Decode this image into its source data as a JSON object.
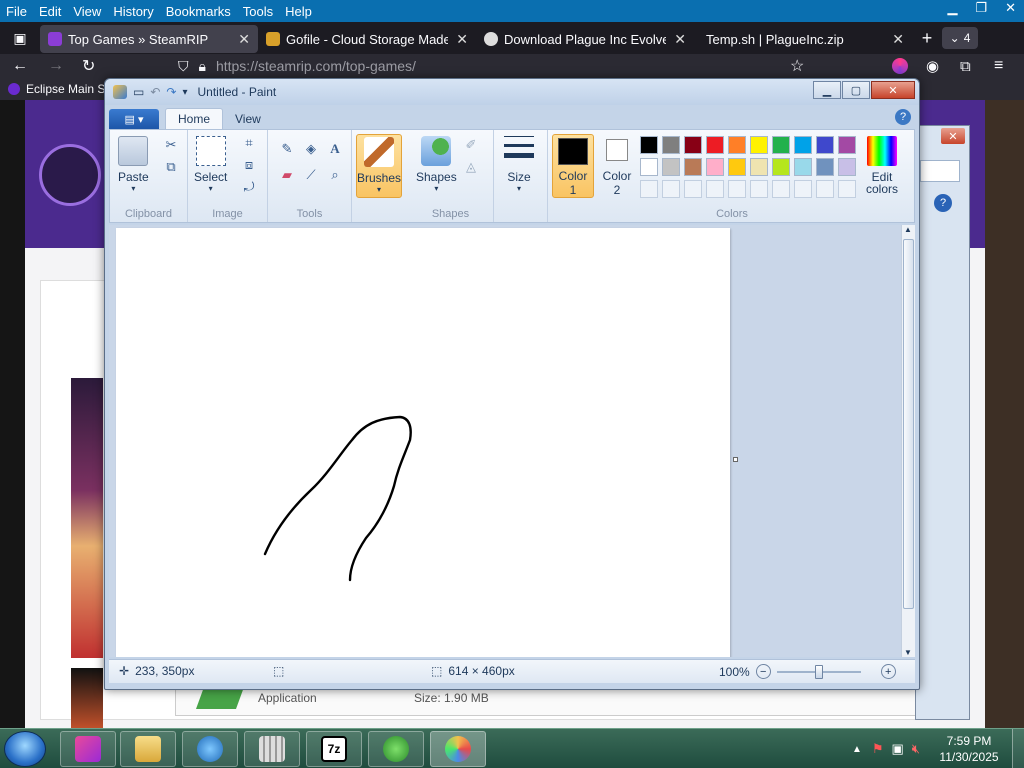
{
  "firefox": {
    "menu": [
      "File",
      "Edit",
      "View",
      "History",
      "Bookmarks",
      "Tools",
      "Help"
    ],
    "tabs": [
      {
        "title": "Top Games » SteamRIP",
        "active": true,
        "favicon_color": "#8b3dd6"
      },
      {
        "title": "Gofile - Cloud Storage Made Si",
        "active": false,
        "favicon_color": "#d8a02a"
      },
      {
        "title": "Download Plague Inc Evolved S",
        "active": false,
        "favicon_color": "#dddddd"
      },
      {
        "title": "Temp.sh | PlagueInc.zip",
        "active": false,
        "favicon_color": "#2b2a33"
      }
    ],
    "tab_count": "4",
    "url": "https://steamrip.com/top-games/",
    "bookmark": "Eclipse Main S"
  },
  "webpage": {
    "row_type": "Application",
    "row_size": "Size: 1.90 MB"
  },
  "paint": {
    "title": "Untitled - Paint",
    "tabs": [
      "Home",
      "View"
    ],
    "groups": {
      "clipboard": "Clipboard",
      "image": "Image",
      "tools": "Tools",
      "shapes": "Shapes",
      "colors": "Colors"
    },
    "buttons": {
      "paste": "Paste",
      "select": "Select",
      "brushes": "Brushes",
      "shapes": "Shapes",
      "size": "Size",
      "color1_a": "Color",
      "color1_b": "1",
      "color2_a": "Color",
      "color2_b": "2",
      "edit_colors_a": "Edit",
      "edit_colors_b": "colors"
    },
    "color1": "#000000",
    "color2": "#ffffff",
    "palette_row1": [
      "#000000",
      "#7f7f7f",
      "#880015",
      "#ed1c24",
      "#ff7f27",
      "#fff200",
      "#22b14c",
      "#00a2e8",
      "#3f48cc",
      "#a349a4"
    ],
    "palette_row2": [
      "#ffffff",
      "#c3c3c3",
      "#b97a57",
      "#ffaec9",
      "#ffc90e",
      "#efe4b0",
      "#b5e61d",
      "#99d9ea",
      "#7092be",
      "#c8bfe7"
    ],
    "status": {
      "cursor_pos": "233, 350px",
      "canvas_size": "614 × 460px",
      "zoom": "100%"
    }
  },
  "taskbar": {
    "time": "7:59 PM",
    "date": "11/30/2025"
  }
}
